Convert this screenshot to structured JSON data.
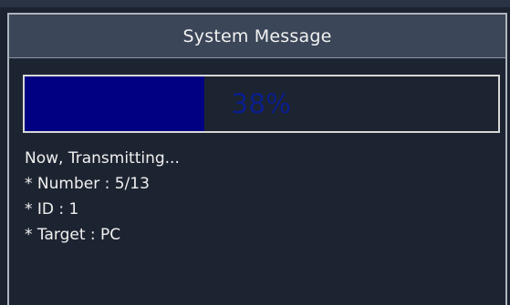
{
  "dialog": {
    "title": "System Message"
  },
  "progress": {
    "value_percent": 38,
    "label": "38%",
    "fill_color": "#020082"
  },
  "status": {
    "heading": "Now, Transmitting...",
    "number": "* Number : 5/13",
    "id": "* ID : 1",
    "target": "* Target : PC"
  },
  "colors": {
    "background": "#1b2230",
    "title_bar": "#3b4658",
    "border": "#aeb4bd"
  }
}
